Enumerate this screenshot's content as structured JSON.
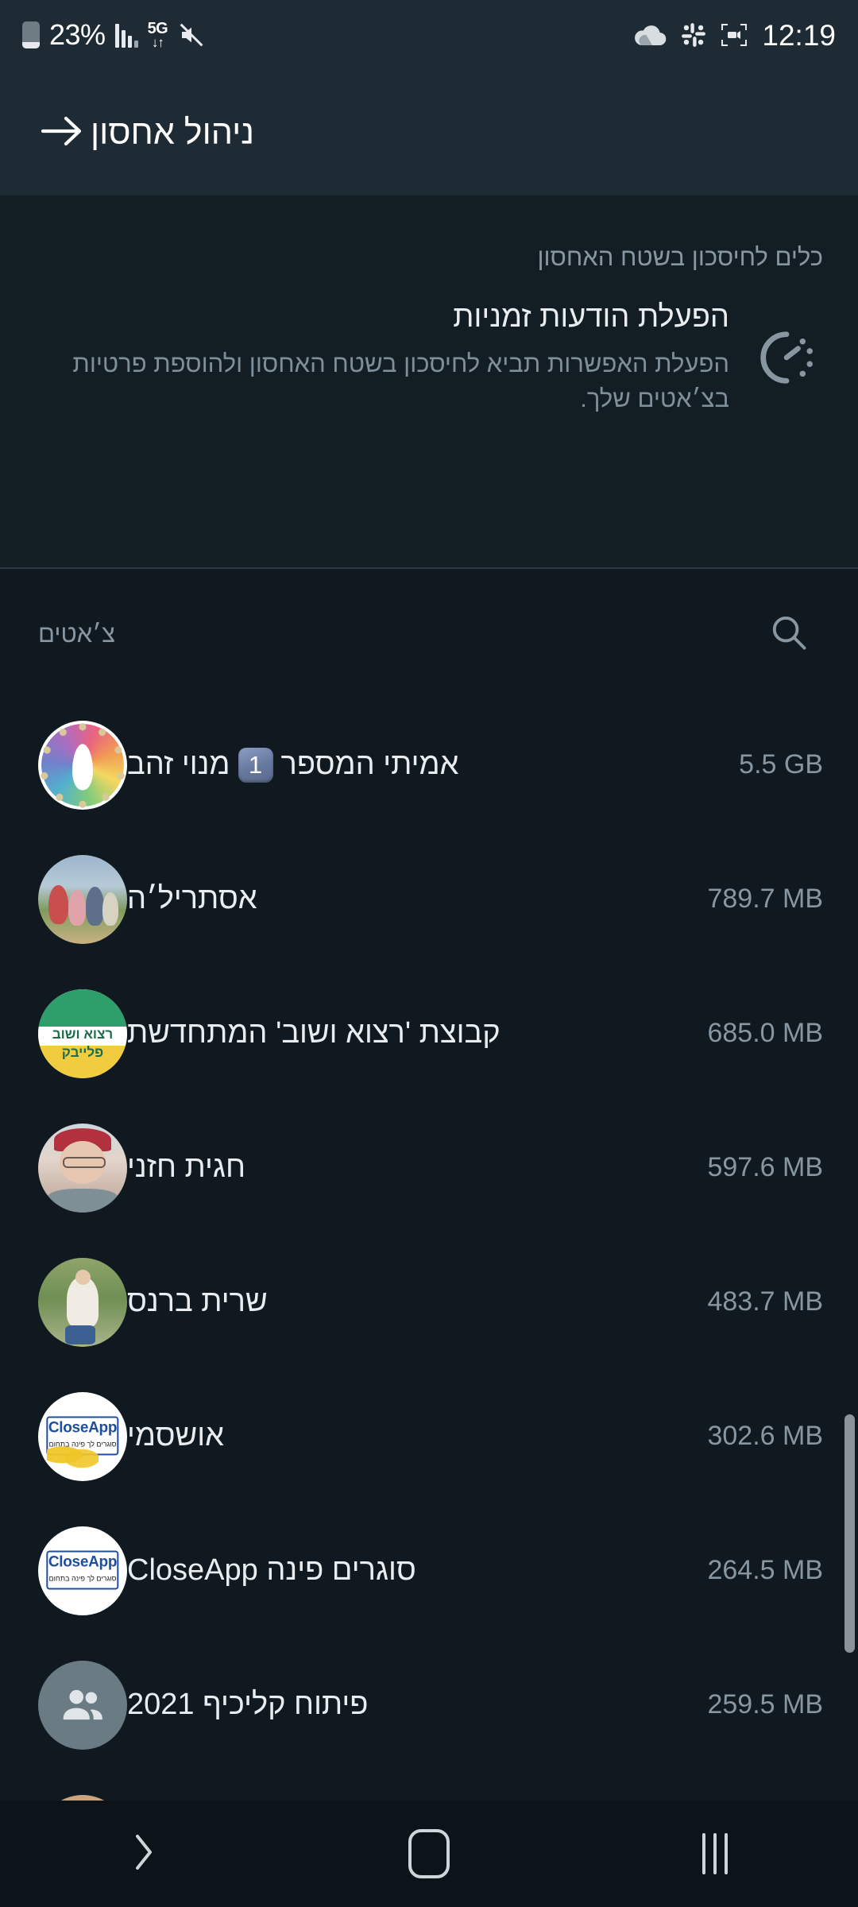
{
  "status_bar": {
    "battery_percent": "23%",
    "battery_icon": "battery-icon",
    "signal_icon": "signal-bars-icon",
    "network_label": "5G",
    "network_data_icon": "data-transfer-arrows-icon",
    "mute_icon": "volume-mute-icon",
    "cloud_icon": "onedrive-cloud-icon",
    "slack_icon": "slack-icon",
    "screen_recorder_icon": "screen-recorder-icon",
    "time": "12:19"
  },
  "app_bar": {
    "title": "ניהול אחסון",
    "back_icon": "arrow-right-icon"
  },
  "info_card": {
    "kicker": "כלים לחיסכון בשטח האחסון",
    "title": "הפעלת הודעות זמניות",
    "subtitle": "הפעלת האפשרות תביא לחיסכון בשטח האחסון ולהוספת פרטיות בצ׳אטים שלך.",
    "icon": "disappearing-messages-timer-icon"
  },
  "section": {
    "label": "צ׳אטים",
    "search_icon": "search-icon"
  },
  "chats": [
    {
      "name": "מנוי זהב 1️⃣ אמיתי המספר",
      "name_before_badge": "מנוי זהב",
      "badge": "1",
      "name_after_badge": "אמיתי המספר",
      "size": "5.5 GB",
      "avatar": "rainbow-logo-avatar"
    },
    {
      "name": "אסתריל׳ה",
      "size": "789.7 MB",
      "avatar": "family-photo-avatar"
    },
    {
      "name": "קבוצת 'רצוא ושוב' המתחדשת",
      "size": "685.0 MB",
      "avatar": "green-yellow-logo-avatar",
      "avatar_text_top": "רצוא ושוב",
      "avatar_text_bottom": "פלייבק"
    },
    {
      "name": "חגית חזני",
      "size": "597.6 MB",
      "avatar": "woman-portrait-avatar"
    },
    {
      "name": "שרית ברנס",
      "size": "483.7 MB",
      "avatar": "woman-outdoor-photo-avatar"
    },
    {
      "name": "אושסמי",
      "size": "302.6 MB",
      "avatar": "closeapp-logo-scribble-avatar",
      "avatar_text_top": "CloseApp",
      "avatar_text_bottom": "סוגרים לך פינה בתחום"
    },
    {
      "name": "סוגרים פינה CloseApp",
      "size": "264.5 MB",
      "avatar": "closeapp-logo-avatar",
      "avatar_text_top": "CloseApp",
      "avatar_text_bottom": "סוגרים לך פינה בתחום"
    },
    {
      "name": "פיתוח קליכיף 2021",
      "size": "259.5 MB",
      "avatar": "default-group-avatar"
    }
  ],
  "scrollbar": {
    "name": "vertical-scrollbar"
  },
  "nav_bar": {
    "recents_icon": "recents-icon",
    "home_icon": "home-icon",
    "back_icon": "chevron-right-back-icon"
  },
  "colors": {
    "app_bar_bg": "#1e2b34",
    "page_bg": "#0f191f",
    "card_bg": "#121e24",
    "nav_bg": "#0c1419",
    "primary_text": "#e9edef",
    "secondary_text": "#8796a1",
    "divider": "#2a3942"
  }
}
